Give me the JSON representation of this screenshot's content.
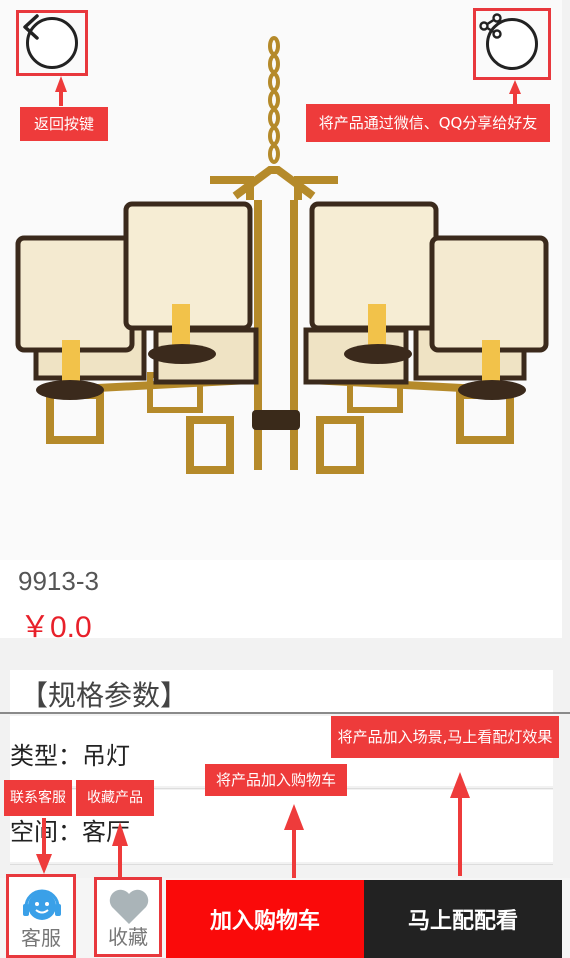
{
  "product": {
    "model": "9913-3",
    "price": "￥0.0"
  },
  "specs": {
    "title": "【规格参数】",
    "rows": [
      {
        "label": "类型：吊灯"
      },
      {
        "label": "空间：客厅"
      }
    ]
  },
  "bottom_bar": {
    "customer_service_label": "客服",
    "favorite_label": "收藏",
    "add_to_cart_label": "加入购物车",
    "try_match_label": "马上配配看"
  },
  "annotations": {
    "back": "返回按键",
    "share": "将产品通过微信、QQ分享给好友",
    "scene": "将产品加入场景,马上看配灯效果",
    "cart": "将产品加入购物车",
    "customer_service": "联系客服",
    "favorite": "收藏产品"
  },
  "colors": {
    "accent_red": "#fa0a0a",
    "callout_red": "#ee3b3b",
    "dark_button": "#222222",
    "price_red": "#e8202a",
    "cs_icon_blue": "#3aa0e8",
    "heart_gray": "#aab4b8"
  },
  "icons": {
    "back": "chevron-left-icon",
    "share": "share-icon",
    "customer_service": "headset-icon",
    "favorite": "heart-icon"
  }
}
